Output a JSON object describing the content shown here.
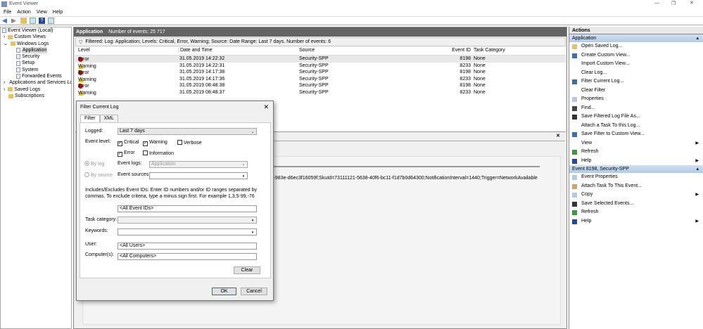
{
  "window": {
    "title": "Event Viewer"
  },
  "menu": [
    "File",
    "Action",
    "View",
    "Help"
  ],
  "tree": [
    {
      "label": "Event Viewer (Local)",
      "level": 0
    },
    {
      "label": "Custom Views",
      "level": 1
    },
    {
      "label": "Windows Logs",
      "level": 1
    },
    {
      "label": "Application",
      "level": 2
    },
    {
      "label": "Security",
      "level": 2
    },
    {
      "label": "Setup",
      "level": 2
    },
    {
      "label": "System",
      "level": 2
    },
    {
      "label": "Forwarded Events",
      "level": 2
    },
    {
      "label": "Applications and Services Lo",
      "level": 1
    },
    {
      "label": "Saved Logs",
      "level": 1
    },
    {
      "label": "Subscriptions",
      "level": 1
    }
  ],
  "center": {
    "log_name": "Application",
    "event_count": "Number of events: 25 717",
    "filter_text": "Filtered: Log: Application; Levels: Critical, Error, Warning; Source: Date Range: Last 7 days. Number of events: 6",
    "columns": [
      "Level",
      "Date and Time",
      "Source",
      "Event ID",
      "Task Category"
    ],
    "rows": [
      {
        "level": "Error",
        "date": "31.05.2019 14:22:32",
        "source": "Security-SPP",
        "id": "8198",
        "cat": "None"
      },
      {
        "level": "Warning",
        "date": "31.05.2019 14:22:31",
        "source": "Security-SPP",
        "id": "8233",
        "cat": "None"
      },
      {
        "level": "Error",
        "date": "31.05.2019 14:17:38",
        "source": "Security-SPP",
        "id": "8198",
        "cat": "None"
      },
      {
        "level": "Warning",
        "date": "31.05.2019 14:17:36",
        "source": "Security-SPP",
        "id": "8233",
        "cat": "None"
      },
      {
        "level": "Error",
        "date": "31.05.2019 08:48:38",
        "source": "Security-SPP",
        "id": "8198",
        "cat": "None"
      },
      {
        "level": "Warning",
        "date": "31.05.2019 08:48:37",
        "source": "Security-SPP",
        "id": "8233",
        "cat": "None"
      }
    ],
    "detail_text": "4d71-983e-d6ec3f16059f;SkuId=73111121-5638-40f6-bc11-f1d7b0d64300;NotificationInterval=1440;Trigger=NetworkAvailable"
  },
  "actions": {
    "title": "Actions",
    "section1": "Application",
    "items1": [
      "Open Saved Log...",
      "Create Custom View...",
      "Import Custom View...",
      "Clear Log...",
      "Filter Current Log...",
      "Clear Filter",
      "Properties",
      "Find...",
      "Save Filtered Log File As...",
      "Attach a Task To this Log...",
      "Save Filter to Custom View...",
      "View",
      "Refresh",
      "Help"
    ],
    "section2": "Event 8198, Security-SPP",
    "items2": [
      "Event Properties",
      "Attach Task To This Event...",
      "Copy",
      "Save Selected Events...",
      "Refresh",
      "Help"
    ]
  },
  "dialog": {
    "title": "Filter Current Log",
    "tabs": [
      "Filter",
      "XML"
    ],
    "logged_label": "Logged:",
    "logged_value": "Last 7 days",
    "event_level_label": "Event level:",
    "levels": {
      "critical": "Critical",
      "warning": "Warning",
      "verbose": "Verbose",
      "error": "Error",
      "information": "Information"
    },
    "by_log": "By log",
    "by_source": "By source",
    "event_logs_label": "Event logs:",
    "event_logs_value": "Application",
    "event_sources_label": "Event sources:",
    "ids_help": "Includes/Excludes Event IDs: Enter ID numbers and/or ID ranges separated by commas. To exclude criteria, type a minus sign first. For example 1,3,5-99,-76",
    "ids_value": "<All Event IDs>",
    "task_category_label": "Task category:",
    "keywords_label": "Keywords:",
    "user_label": "User:",
    "user_value": "<All Users>",
    "computers_label": "Computer(s):",
    "computers_value": "<All Computers>",
    "clear": "Clear",
    "ok": "OK",
    "cancel": "Cancel"
  }
}
